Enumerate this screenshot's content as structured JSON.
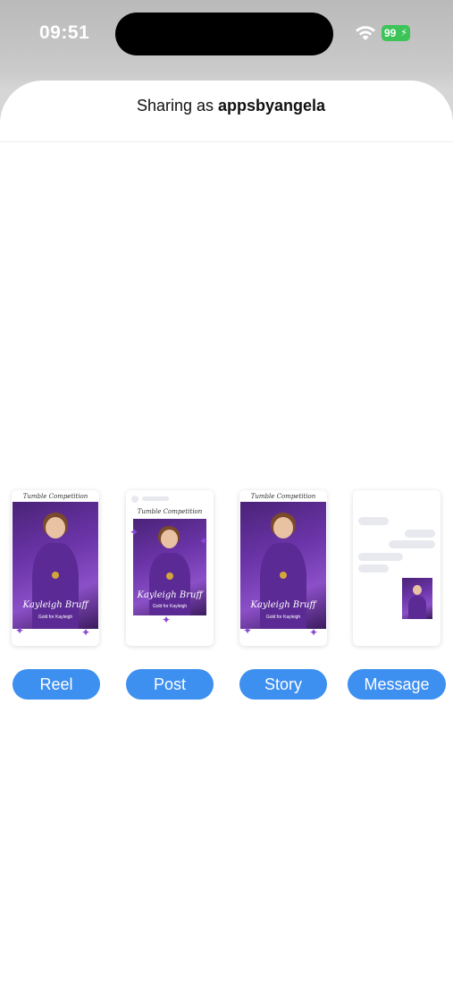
{
  "status_bar": {
    "time": "09:51",
    "battery_level": "99"
  },
  "sheet": {
    "sharing_prefix": "Sharing as",
    "username": "appsbyangela"
  },
  "preview": {
    "event_title": "Tumble Competition",
    "athlete_name": "Kayleigh Bruff",
    "caption": "Gold for Kayleigh"
  },
  "share_options": [
    {
      "label": "Reel"
    },
    {
      "label": "Post"
    },
    {
      "label": "Story"
    },
    {
      "label": "Message"
    }
  ],
  "colors": {
    "accent": "#3d8ff0",
    "battery": "#3cc459",
    "photo_purple": "#6b34a8"
  }
}
